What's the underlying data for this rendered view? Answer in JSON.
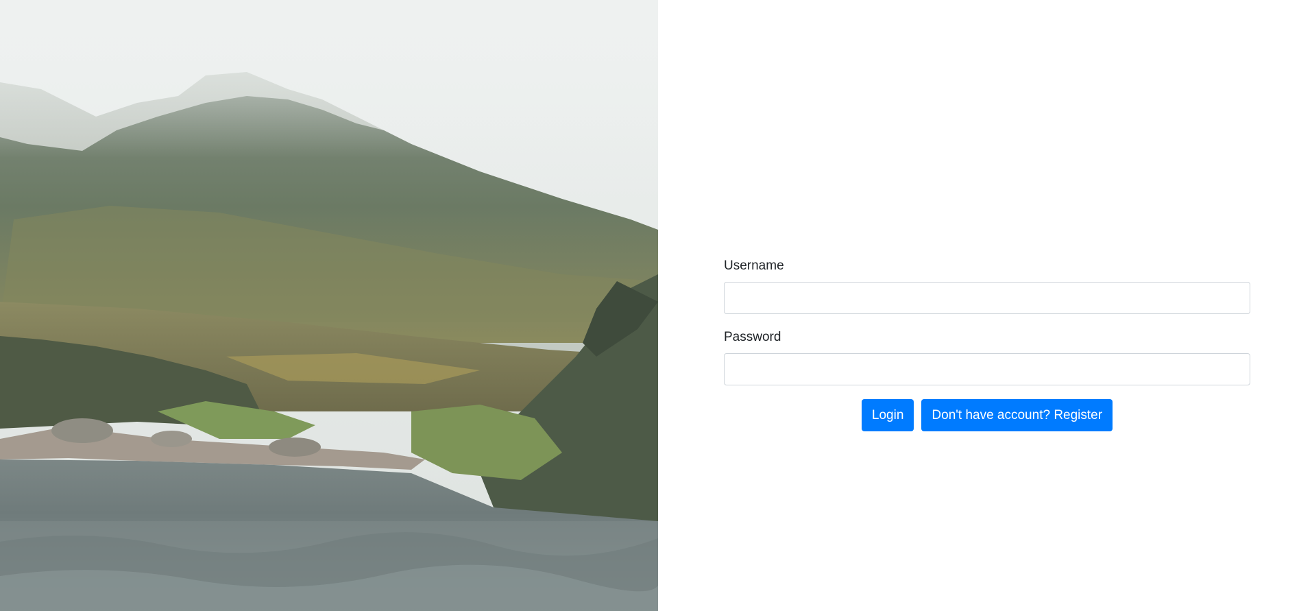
{
  "hero": {
    "image_alt": "Misty mountain landscape with a river in the foreground"
  },
  "login_form": {
    "username_label": "Username",
    "username_value": "",
    "password_label": "Password",
    "password_value": "",
    "login_button": "Login",
    "register_button": "Don't have account? Register"
  },
  "colors": {
    "primary": "#007bff",
    "text": "#212529",
    "input_border": "#ced4da",
    "background": "#ffffff"
  }
}
